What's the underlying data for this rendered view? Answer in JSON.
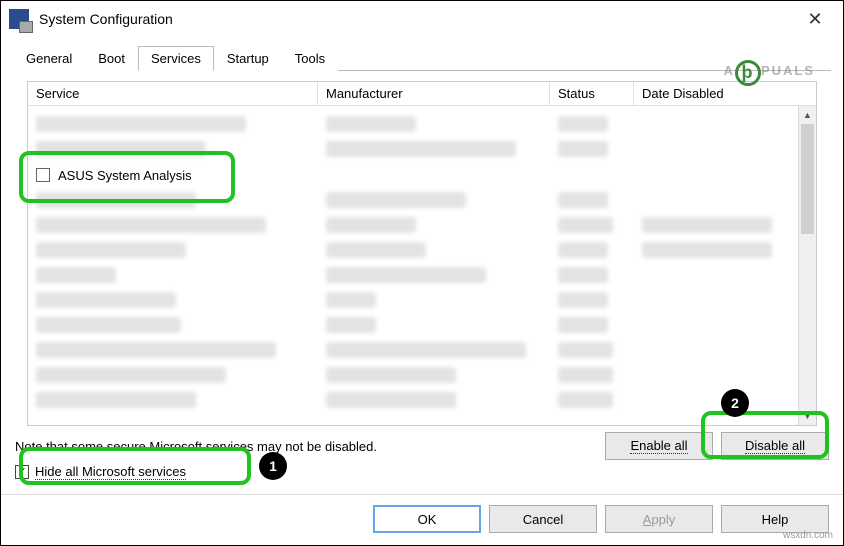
{
  "window": {
    "title": "System Configuration"
  },
  "tabs": {
    "general": "General",
    "boot": "Boot",
    "services": "Services",
    "startup": "Startup",
    "tools": "Tools",
    "active": "services"
  },
  "columns": {
    "service": "Service",
    "manufacturer": "Manufacturer",
    "status": "Status",
    "date_disabled": "Date Disabled"
  },
  "highlighted_service": {
    "name": "ASUS System Analysis",
    "checked": false
  },
  "note": "Note that some secure Microsoft services may not be disabled.",
  "buttons": {
    "enable_all": "Enable all",
    "disable_all": "Disable all",
    "ok": "OK",
    "cancel": "Cancel",
    "apply": "Apply",
    "help": "Help"
  },
  "hide_ms": {
    "label": "Hide all Microsoft services",
    "checked": true
  },
  "annotations": {
    "badge1": "1",
    "badge2": "2"
  },
  "watermark": {
    "prefix": "A",
    "suffix": "PUALS"
  },
  "footer": "wsxdn.com"
}
